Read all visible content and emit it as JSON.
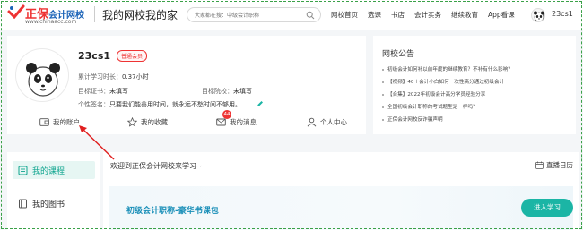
{
  "header": {
    "logo_main": "正保",
    "logo_main_blue": "会计网校",
    "logo_sub": "www.chinaacc.com",
    "title": "我的网校我的家",
    "search_placeholder": "大家都在搜：中级会计职称",
    "nav": [
      "网校首页",
      "选课",
      "书店",
      "会计实务",
      "继续教育",
      "App看课"
    ],
    "username": "23cs1"
  },
  "profile": {
    "name": "23cs1",
    "badge": "普通会员",
    "study_time_label": "累计学习时长：",
    "study_time_value": "0.37小时",
    "target_cert_label": "目标证书：",
    "target_cert_value": "未填写",
    "target_school_label": "目标院校：",
    "target_school_value": "未填写",
    "signature_label": "个性签名：",
    "signature_value": "只要我们能善用时间，就永远不愁时间不够用。"
  },
  "quick_links": {
    "account": "我的账户",
    "favorites": "我的收藏",
    "messages": "我的消息",
    "messages_count": "44",
    "center": "个人中心"
  },
  "announcements": {
    "title": "网校公告",
    "items": [
      "初级会计如何补以前年度的继续教育？不补有什么影响？",
      "【视频】40＋会计小白如何一次性高分通过初级会计",
      "【合集】2022年初级会计高分学员经验分享",
      "全国初级会计职称的考试题型是一样吗？",
      "正保会计网校反诈骗声明"
    ]
  },
  "sidebar": {
    "items": [
      "我的课程",
      "我的图书"
    ]
  },
  "main": {
    "welcome": "欢迎到正保会计网校来学习~",
    "calendar_label": "直播日历",
    "course_name": "初级会计职称-豪华书课包",
    "study_button": "进入学习"
  },
  "colors": {
    "accent": "#1bb5a5",
    "brand_red": "#e33333",
    "brand_blue": "#1c64b8",
    "annotation_arrow": "#e02020",
    "frame": "#3aa148"
  }
}
